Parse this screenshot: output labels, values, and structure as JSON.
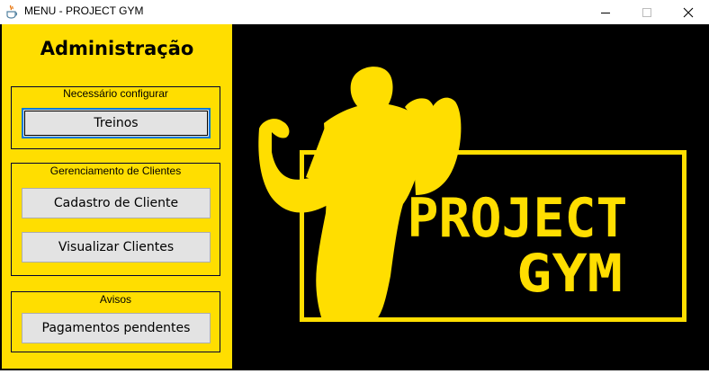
{
  "window": {
    "title": "MENU - PROJECT GYM",
    "app_icon": "java-cup-icon",
    "controls": {
      "minimize": "minimize-icon",
      "maximize": "maximize-icon",
      "close": "close-icon"
    }
  },
  "colors": {
    "brand_yellow": "#ffde00",
    "background": "#000000",
    "button_bg": "#e3e3e3",
    "focus_border": "#0078d7"
  },
  "sidebar": {
    "title": "Administração",
    "groups": [
      {
        "label": "Necessário configurar",
        "buttons": [
          {
            "label": "Treinos"
          }
        ]
      },
      {
        "label": "Gerenciamento de Clientes",
        "buttons": [
          {
            "label": "Cadastro de Cliente"
          },
          {
            "label": "Visualizar Clientes"
          }
        ]
      },
      {
        "label": "Avisos",
        "buttons": [
          {
            "label": "Pagamentos pendentes"
          }
        ]
      }
    ]
  },
  "logo": {
    "line1": "PROJECT",
    "line2": "GYM"
  }
}
